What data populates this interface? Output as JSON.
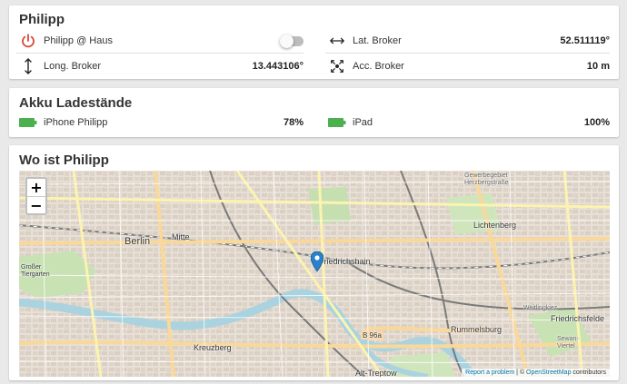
{
  "card1": {
    "title": "Philipp",
    "presence": {
      "label": "Philipp @ Haus",
      "state": "off"
    },
    "lat": {
      "label": "Lat. Broker",
      "value": "52.511119°"
    },
    "long": {
      "label": "Long. Broker",
      "value": "13.443106°"
    },
    "acc": {
      "label": "Acc. Broker",
      "value": "10 m"
    }
  },
  "card2": {
    "title": "Akku Ladestände",
    "iphone": {
      "label": "iPhone Philipp",
      "value": "78%"
    },
    "ipad": {
      "label": "iPad",
      "value": "100%"
    }
  },
  "card3": {
    "title": "Wo ist Philipp",
    "zoom_in": "+",
    "zoom_out": "−",
    "labels": {
      "berlin": "Berlin",
      "mitte": "Mitte",
      "friedrichshain": "Friedrichshain",
      "lichtenberg": "Lichtenberg",
      "rummelsburg": "Rummelsburg",
      "kreuzberg": "Kreuzberg",
      "friedrichsfelde": "Friedrichsfelde",
      "alt_treptow": "Alt-Treptow",
      "tiergarten": "Großer Tiergarten",
      "b96a": "B 96a",
      "gewerbegebiet": "Gewerbegebiet Herzbergstraße",
      "weitlingkiez": "Weitlingkiez",
      "sewan": "Sewan-Viertel"
    },
    "attribution": {
      "report": "Report a problem",
      "sep": " | © ",
      "osm": "OpenStreetMap",
      "contrib": " contributors"
    }
  },
  "colors": {
    "power_icon": "#db4437",
    "battery": "#4caf50",
    "marker": "#2a81cb"
  }
}
